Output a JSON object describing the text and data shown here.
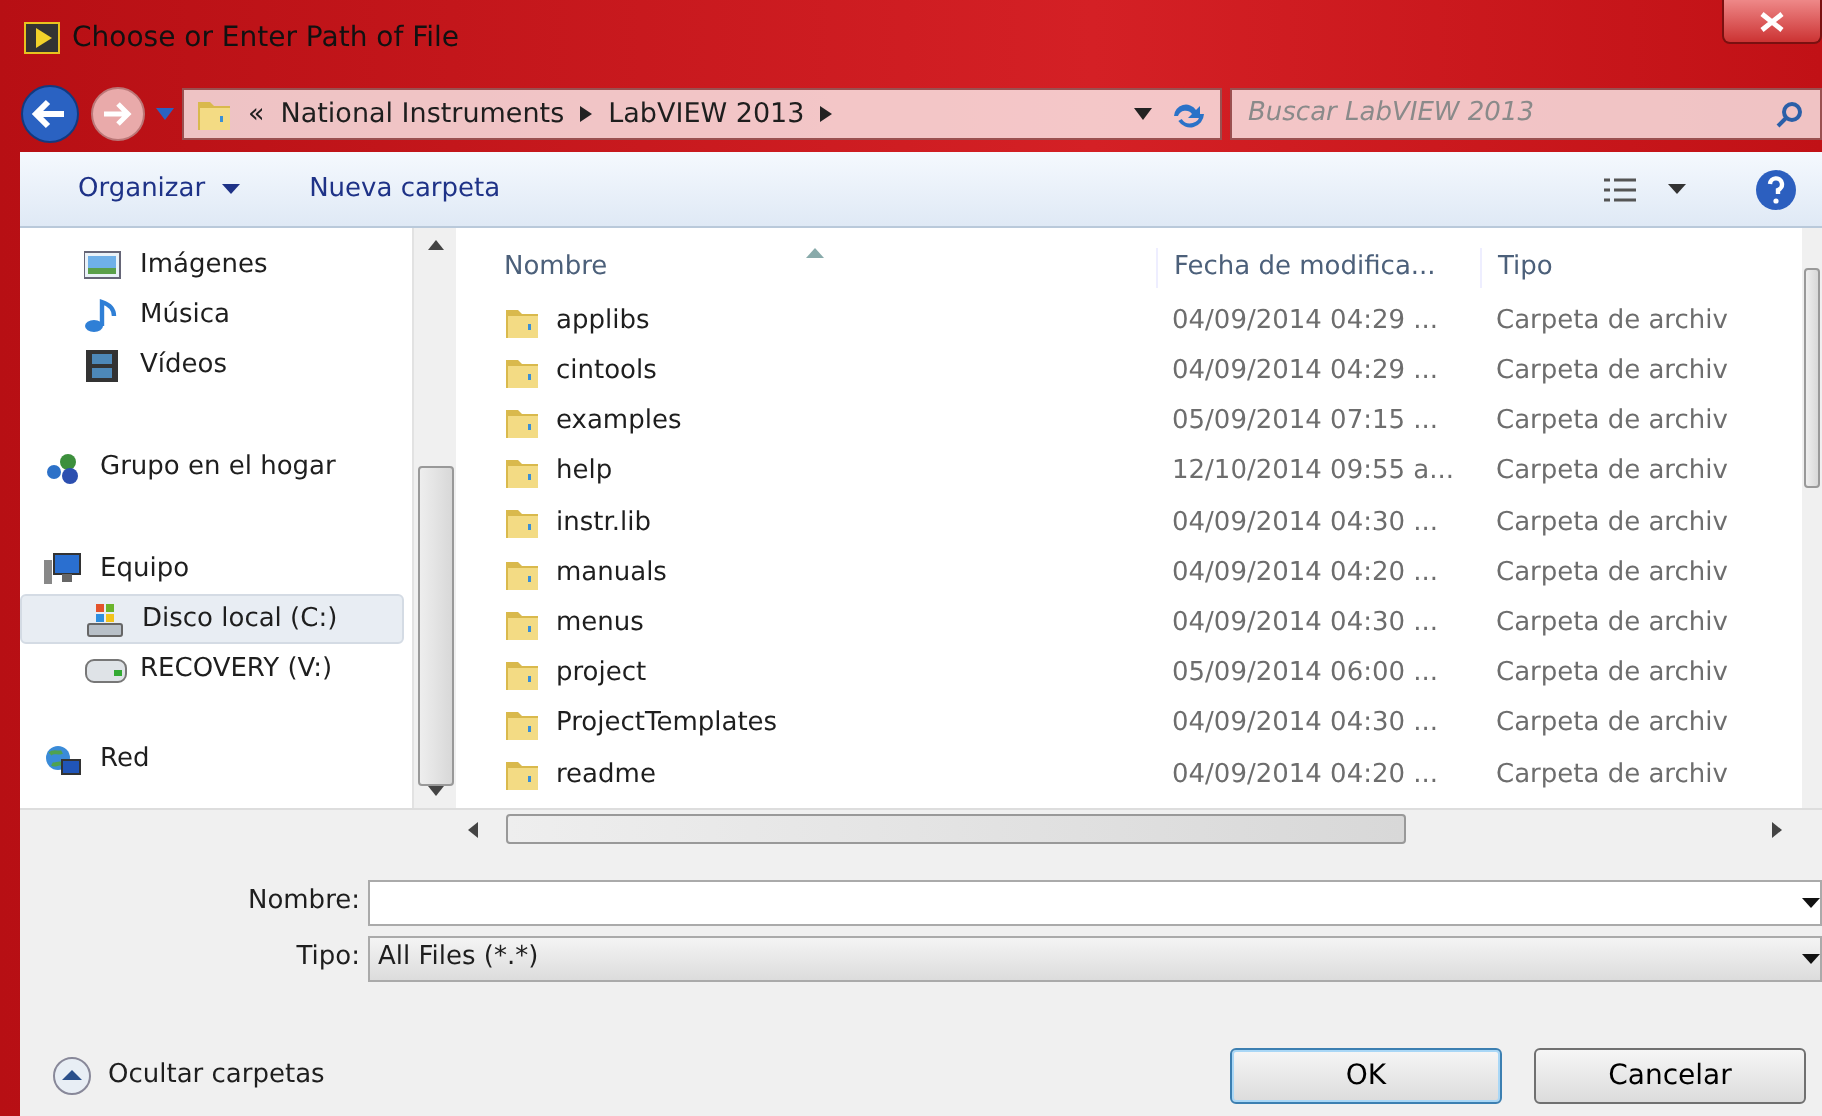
{
  "window": {
    "title": "Choose or Enter Path of File"
  },
  "address": {
    "overflow": "«",
    "crumbs": [
      "National Instruments",
      "LabVIEW 2013"
    ],
    "search_placeholder": "Buscar LabVIEW 2013"
  },
  "toolbar": {
    "organize": "Organizar",
    "new_folder": "Nueva carpeta"
  },
  "sidebar": {
    "sections": [
      {
        "children": [
          {
            "label": "Imágenes",
            "kind": "pictures",
            "selected": false
          },
          {
            "label": "Música",
            "kind": "music",
            "selected": false
          },
          {
            "label": "Vídeos",
            "kind": "videos",
            "selected": false
          }
        ]
      },
      {
        "label": "Grupo en el hogar",
        "kind": "homegroup",
        "selected": false
      },
      {
        "label": "Equipo",
        "kind": "computer",
        "selected": false,
        "children": [
          {
            "label": "Disco local (C:)",
            "kind": "windows-drive",
            "selected": true
          },
          {
            "label": "RECOVERY (V:)",
            "kind": "drive",
            "selected": false
          }
        ]
      },
      {
        "label": "Red",
        "kind": "network",
        "selected": false
      }
    ]
  },
  "table": {
    "columns": [
      {
        "label": "Nombre",
        "sorted": true
      },
      {
        "label": "Fecha de modifica...",
        "sorted": false
      },
      {
        "label": "Tipo",
        "sorted": false
      }
    ],
    "rows": [
      {
        "name": "applibs",
        "date": "04/09/2014 04:29 ...",
        "type": "Carpeta de archiv"
      },
      {
        "name": "cintools",
        "date": "04/09/2014 04:29 ...",
        "type": "Carpeta de archiv"
      },
      {
        "name": "examples",
        "date": "05/09/2014 07:15 ...",
        "type": "Carpeta de archiv"
      },
      {
        "name": "help",
        "date": "12/10/2014 09:55 a...",
        "type": "Carpeta de archiv"
      },
      {
        "name": "instr.lib",
        "date": "04/09/2014 04:30 ...",
        "type": "Carpeta de archiv"
      },
      {
        "name": "manuals",
        "date": "04/09/2014 04:20 ...",
        "type": "Carpeta de archiv"
      },
      {
        "name": "menus",
        "date": "04/09/2014 04:30 ...",
        "type": "Carpeta de archiv"
      },
      {
        "name": "project",
        "date": "05/09/2014 06:00 ...",
        "type": "Carpeta de archiv"
      },
      {
        "name": "ProjectTemplates",
        "date": "04/09/2014 04:30 ...",
        "type": "Carpeta de archiv"
      },
      {
        "name": "readme",
        "date": "04/09/2014 04:20 ...",
        "type": "Carpeta de archiv"
      }
    ]
  },
  "form": {
    "name_label": "Nombre:",
    "type_label": "Tipo:",
    "type_value": "All Files (*.*)"
  },
  "footer": {
    "hide_folders": "Ocultar carpetas",
    "ok": "OK",
    "cancel": "Cancelar"
  }
}
